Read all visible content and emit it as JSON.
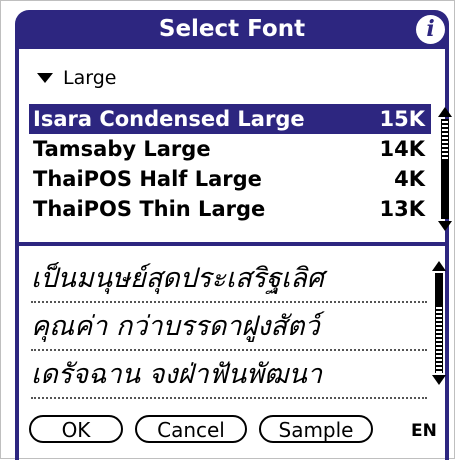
{
  "dialog": {
    "title": "Select Font",
    "info_icon": "info-icon"
  },
  "category": {
    "label": "Large"
  },
  "font_list": [
    {
      "name": "Isara Condensed Large",
      "size": "15K",
      "selected": true
    },
    {
      "name": "Tamsaby Large",
      "size": "14K",
      "selected": false
    },
    {
      "name": "ThaiPOS Half Large",
      "size": "4K",
      "selected": false
    },
    {
      "name": "ThaiPOS Thin Large",
      "size": "13K",
      "selected": false
    }
  ],
  "sample_lines": [
    "เป็นมนุษย์สุดประเสริฐเลิศ",
    "คุณค่า กว่าบรรดาฝูงสัตว์",
    "เดรัจฉาน จงฝ่าฟันพัฒนา"
  ],
  "buttons": {
    "ok": "OK",
    "cancel": "Cancel",
    "sample": "Sample"
  },
  "language": "EN",
  "colors": {
    "accent": "#2d2680"
  }
}
